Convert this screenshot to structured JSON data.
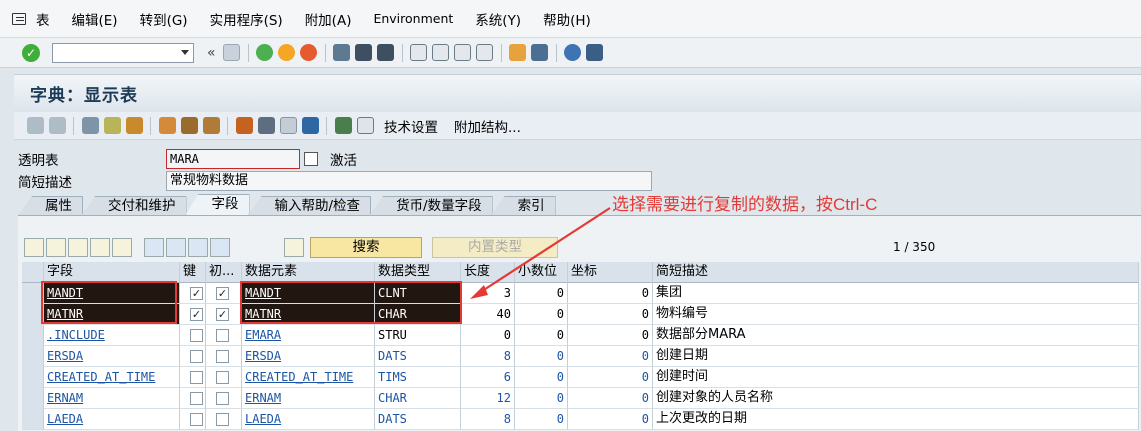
{
  "menubar": {
    "items": [
      "表",
      "编辑(E)",
      "转到(G)",
      "实用程序(S)",
      "附加(A)",
      "Environment",
      "系统(Y)",
      "帮助(H)"
    ]
  },
  "toolbar": {
    "back_chevrons": "«"
  },
  "title": "字典：显示表",
  "app_toolbar": {
    "tech_settings": "技术设置",
    "append_structure": "附加结构..."
  },
  "form": {
    "transparent_table_label": "透明表",
    "table_name": "MARA",
    "status": "激活",
    "short_desc_label": "简短描述",
    "short_desc_value": "常规物料数据"
  },
  "tabs": [
    "属性",
    "交付和维护",
    "字段",
    "输入帮助/检查",
    "货币/数量字段",
    "索引"
  ],
  "annotation": "选择需要进行复制的数据，按Ctrl-C",
  "table_toolbar": {
    "search_label": "搜索",
    "builtin_type_label": "内置类型",
    "counter": "1 / 350"
  },
  "grid": {
    "headers": [
      "字段",
      "键",
      "初...",
      "数据元素",
      "数据类型",
      "长度",
      "小数位",
      "坐标",
      "简短描述"
    ],
    "rows": [
      {
        "field": "MANDT",
        "key": "✓",
        "init": "✓",
        "element": "MANDT",
        "type": "CLNT",
        "length": "3",
        "decimals": "0",
        "coord": "0",
        "desc": "集团"
      },
      {
        "field": "MATNR",
        "key": "✓",
        "init": "✓",
        "element": "MATNR",
        "type": "CHAR",
        "length": "40",
        "decimals": "0",
        "coord": "0",
        "desc": "物料编号"
      },
      {
        "field": ".INCLUDE",
        "key": "",
        "init": "",
        "element": "EMARA",
        "type": "STRU",
        "length": "0",
        "decimals": "0",
        "coord": "0",
        "desc": "数据部分MARA"
      },
      {
        "field": "ERSDA",
        "key": "",
        "init": "",
        "element": "ERSDA",
        "type": "DATS",
        "length": "8",
        "decimals": "0",
        "coord": "0",
        "desc": "创建日期"
      },
      {
        "field": "CREATED_AT_TIME",
        "key": "",
        "init": "",
        "element": "CREATED_AT_TIME",
        "type": "TIMS",
        "length": "6",
        "decimals": "0",
        "coord": "0",
        "desc": "创建时间"
      },
      {
        "field": "ERNAM",
        "key": "",
        "init": "",
        "element": "ERNAM",
        "type": "CHAR",
        "length": "12",
        "decimals": "0",
        "coord": "0",
        "desc": "创建对象的人员名称"
      },
      {
        "field": "LAEDA",
        "key": "",
        "init": "",
        "element": "LAEDA",
        "type": "DATS",
        "length": "8",
        "decimals": "0",
        "coord": "0",
        "desc": "上次更改的日期"
      }
    ]
  },
  "colors": {
    "accent_red": "#e53935",
    "link_blue": "#1c55a6",
    "selection_dark": "#221610"
  }
}
